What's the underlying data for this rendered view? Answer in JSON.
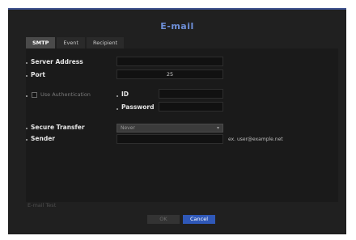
{
  "dialog": {
    "title": "E-mail",
    "tabs": [
      {
        "label": "SMTP",
        "active": true
      },
      {
        "label": "Event",
        "active": false
      },
      {
        "label": "Recipient",
        "active": false
      }
    ]
  },
  "form": {
    "server_address": {
      "label": "Server Address",
      "value": ""
    },
    "port": {
      "label": "Port",
      "value": "25"
    },
    "use_authentication": {
      "label": "Use Authentication",
      "checked": false
    },
    "id": {
      "label": "ID",
      "value": ""
    },
    "password": {
      "label": "Password",
      "value": ""
    },
    "secure_transfer": {
      "label": "Secure Transfer",
      "value": "Never"
    },
    "sender": {
      "label": "Sender",
      "value": "",
      "hint": "ex. user@example.net"
    }
  },
  "email_test": {
    "label": "E-mail Test"
  },
  "buttons": {
    "ok": "OK",
    "cancel": "Cancel"
  },
  "colors": {
    "title": "#6e8fd8",
    "dialog_bg": "#202020",
    "cancel_bg": "#2f58b8"
  }
}
